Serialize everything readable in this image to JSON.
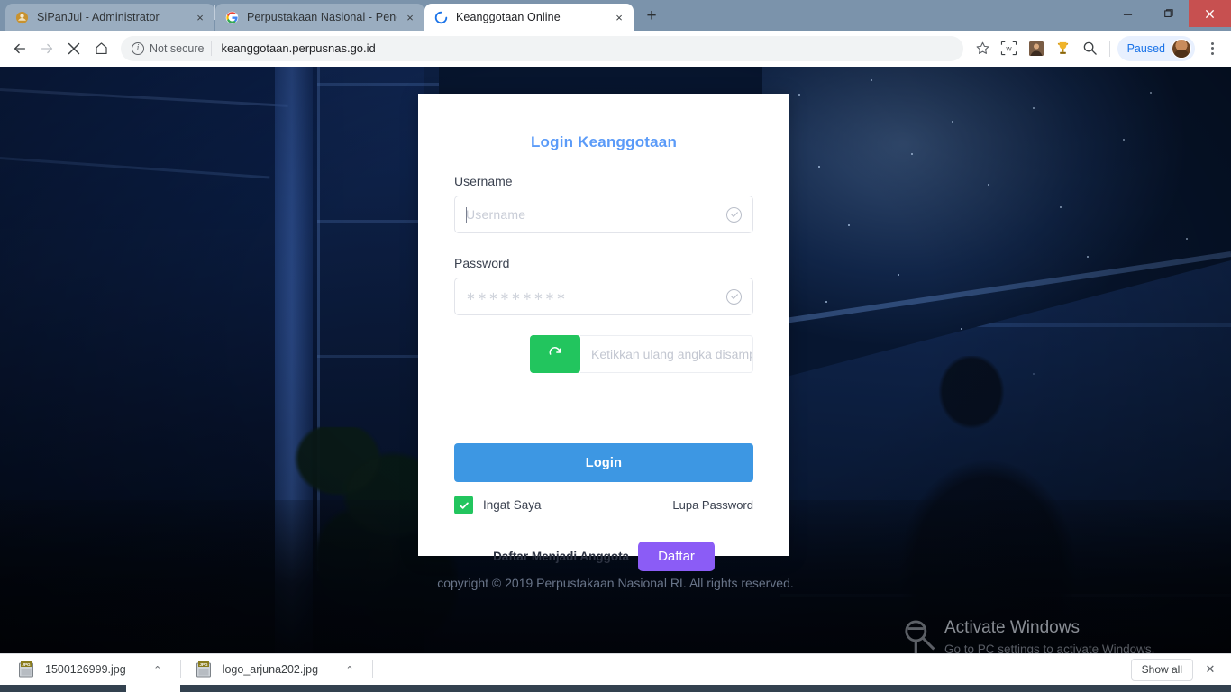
{
  "browser": {
    "tabs": [
      {
        "title": "SiPanJul - Administrator",
        "favicon": "sipanjul-icon",
        "active": false,
        "close_label": "×"
      },
      {
        "title": "Perpustakaan Nasional - Penelus",
        "favicon": "google-icon",
        "active": false,
        "close_label": "×"
      },
      {
        "title": "Keanggotaan Online",
        "favicon": "loading-spinner-icon",
        "active": true,
        "close_label": "×"
      }
    ],
    "new_tab_label": "+",
    "window_controls": {
      "minimize": "—",
      "maximize": "❐",
      "close": "✕"
    },
    "toolbar": {
      "back_label": "←",
      "forward_label": "→",
      "stop_label": "✕",
      "home_label": "⌂",
      "security_label": "Not secure",
      "security_icon": "info-circle-icon",
      "url": "keanggotaan.perpusnas.go.id",
      "bookmark_label": "☆",
      "extensions": [
        "screenshot-extension-icon",
        "photo-extension-icon",
        "trophy-extension-icon",
        "search-extension-icon"
      ],
      "profile_status": "Paused",
      "menu_label": "⋮"
    }
  },
  "page": {
    "card": {
      "title": "Login Keanggotaan",
      "username": {
        "label": "Username",
        "placeholder": "Username",
        "value": ""
      },
      "password": {
        "label": "Password",
        "placeholder": "∗∗∗∗∗∗∗∗∗",
        "value": ""
      },
      "captcha": {
        "refresh_label": "⟳",
        "placeholder": "Ketikkan ulang angka disamping",
        "value": ""
      },
      "login_button": "Login",
      "remember_label": "Ingat Saya",
      "remember_checked": true,
      "forgot_label": "Lupa Password",
      "register_text": "Daftar Menjadi Anggota",
      "register_button": "Daftar"
    },
    "copyright": "copyright © 2019 Perpustakaan Nasional RI. All rights reserved.",
    "colors": {
      "title_blue": "#5b9bf8",
      "login_blue": "#3d97e3",
      "green": "#22c55e",
      "purple": "#8b5cf6"
    }
  },
  "watermark": {
    "title": "Activate Windows",
    "subtitle": "Go to PC settings to activate Windows."
  },
  "download_shelf": {
    "items": [
      {
        "name": "1500126999.jpg",
        "icon": "jpg-file-icon",
        "caret": "⌃"
      },
      {
        "name": "logo_arjuna202.jpg",
        "icon": "jpg-file-icon",
        "caret": "⌃"
      }
    ],
    "show_all_label": "Show all",
    "close_label": "✕"
  }
}
